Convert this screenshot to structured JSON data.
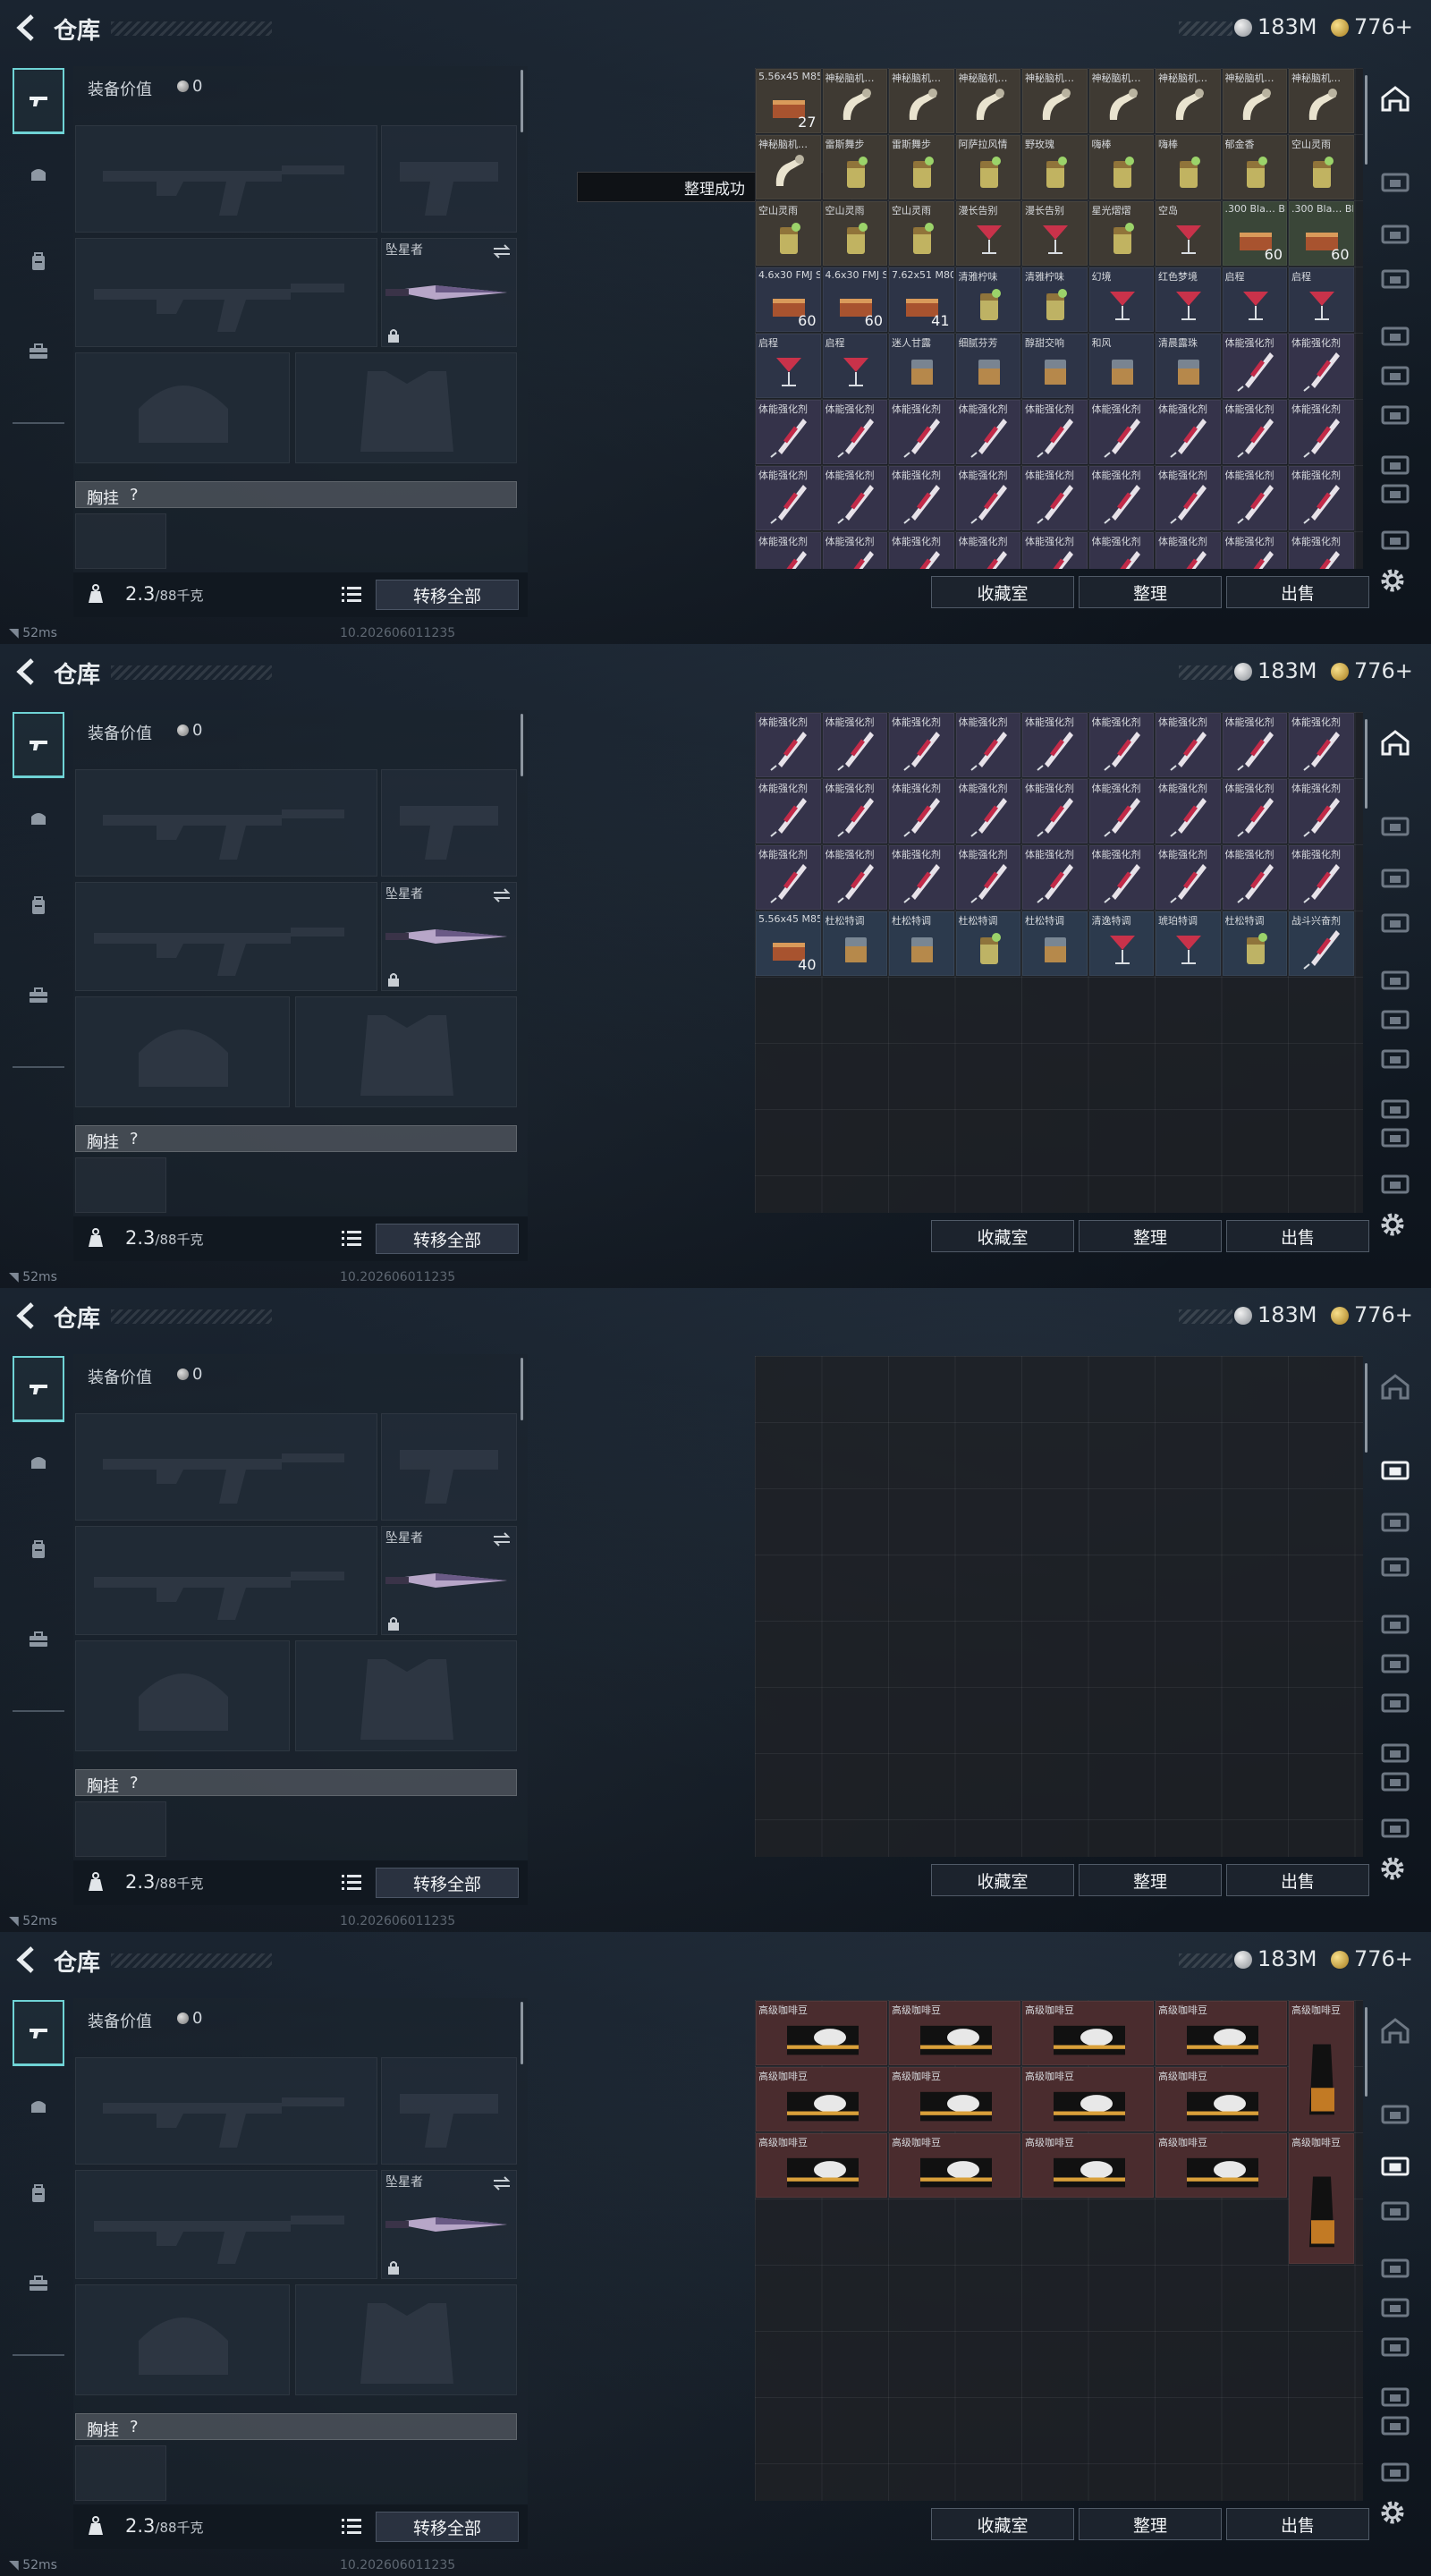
{
  "topbar": {
    "title": "仓库",
    "silver": "183M",
    "gold": "776+"
  },
  "equipment": {
    "value_label": "装备价值",
    "value": "0",
    "melee_label": "坠星者",
    "chest_label": "胸挂",
    "chest_help": "?",
    "weight": "2.3",
    "weight_max": "/88千克",
    "transfer_all": "转移全部"
  },
  "buttons": {
    "collect": "收藏室",
    "sort": "整理",
    "sell": "出售"
  },
  "toast": "整理成功",
  "status": {
    "ping": "52ms",
    "build": "10.202606011235"
  },
  "colors": {
    "accent": "#6fd3d5",
    "silver": "#b8bcc2",
    "gold": "#d3a53a"
  },
  "screens": [
    {
      "show_toast": true,
      "active_tab": 0,
      "cells": [
        {
          "n": "5.56x45 M855",
          "c": "27",
          "k": "ammo",
          "b": "brown"
        },
        {
          "n": "神秘脑机…",
          "c": "",
          "k": "device",
          "b": "brown"
        },
        {
          "n": "神秘脑机…",
          "c": "",
          "k": "device",
          "b": "brown"
        },
        {
          "n": "神秘脑机…",
          "c": "",
          "k": "device",
          "b": "brown"
        },
        {
          "n": "神秘脑机…",
          "c": "",
          "k": "device",
          "b": "brown"
        },
        {
          "n": "神秘脑机…",
          "c": "",
          "k": "device",
          "b": "brown"
        },
        {
          "n": "神秘脑机…",
          "c": "",
          "k": "device",
          "b": "brown"
        },
        {
          "n": "神秘脑机…",
          "c": "",
          "k": "device",
          "b": "brown"
        },
        {
          "n": "神秘脑机…",
          "c": "",
          "k": "device",
          "b": "brown"
        },
        {
          "n": "神秘脑机…",
          "c": "",
          "k": "device",
          "b": "brown"
        },
        {
          "n": "雷斯舞步",
          "c": "",
          "k": "drink",
          "b": "brown"
        },
        {
          "n": "雷斯舞步",
          "c": "",
          "k": "drink",
          "b": "brown"
        },
        {
          "n": "阿萨拉风情",
          "c": "",
          "k": "drink",
          "b": "brown"
        },
        {
          "n": "野玫瑰",
          "c": "",
          "k": "drink",
          "b": "brown"
        },
        {
          "n": "嗨棒",
          "c": "",
          "k": "drink",
          "b": "brown"
        },
        {
          "n": "嗨棒",
          "c": "",
          "k": "drink",
          "b": "brown"
        },
        {
          "n": "郁金香",
          "c": "",
          "k": "drink",
          "b": "brown"
        },
        {
          "n": "空山灵雨",
          "c": "",
          "k": "drink",
          "b": "brown"
        },
        {
          "n": "空山灵雨",
          "c": "",
          "k": "drink",
          "b": "brown"
        },
        {
          "n": "空山灵雨",
          "c": "",
          "k": "drink",
          "b": "brown"
        },
        {
          "n": "空山灵雨",
          "c": "",
          "k": "drink",
          "b": "brown"
        },
        {
          "n": "漫长告别",
          "c": "",
          "k": "cocktail",
          "b": "brown"
        },
        {
          "n": "漫长告别",
          "c": "",
          "k": "cocktail",
          "b": "brown"
        },
        {
          "n": "星光熠熠",
          "c": "",
          "k": "drink",
          "b": "brown"
        },
        {
          "n": "空岛",
          "c": "",
          "k": "cocktail",
          "b": "brown"
        },
        {
          "n": ".300 Bla… BLK FMJ",
          "c": "60",
          "k": "ammo",
          "b": "green"
        },
        {
          "n": ".300 Bla… BLK FMJ",
          "c": "60",
          "k": "ammo",
          "b": "green"
        },
        {
          "n": "4.6x30 FMJ SX",
          "c": "60",
          "k": "ammo",
          "b": "navy"
        },
        {
          "n": "4.6x30 FMJ SX",
          "c": "60",
          "k": "ammo",
          "b": "navy"
        },
        {
          "n": "7.62x51 M80",
          "c": "41",
          "k": "ammo",
          "b": "navy"
        },
        {
          "n": "清雅柠味",
          "c": "",
          "k": "drink",
          "b": "navy"
        },
        {
          "n": "清雅柠味",
          "c": "",
          "k": "drink",
          "b": "navy"
        },
        {
          "n": "幻境",
          "c": "",
          "k": "cocktail",
          "b": "navy"
        },
        {
          "n": "红色梦境",
          "c": "",
          "k": "cocktail",
          "b": "navy"
        },
        {
          "n": "启程",
          "c": "",
          "k": "cocktail",
          "b": "navy"
        },
        {
          "n": "启程",
          "c": "",
          "k": "cocktail",
          "b": "navy"
        },
        {
          "n": "启程",
          "c": "",
          "k": "cocktail",
          "b": "navy"
        },
        {
          "n": "启程",
          "c": "",
          "k": "cocktail",
          "b": "navy"
        },
        {
          "n": "迷人甘露",
          "c": "",
          "k": "glass",
          "b": "navy"
        },
        {
          "n": "细腻芬芳",
          "c": "",
          "k": "glass",
          "b": "navy"
        },
        {
          "n": "醇甜交响",
          "c": "",
          "k": "glass",
          "b": "navy"
        },
        {
          "n": "和风",
          "c": "",
          "k": "glass",
          "b": "navy"
        },
        {
          "n": "清晨露珠",
          "c": "",
          "k": "glass",
          "b": "navy"
        },
        {
          "n": "体能强化剂",
          "c": "",
          "k": "syringe",
          "b": "purple"
        },
        {
          "n": "体能强化剂",
          "c": "",
          "k": "syringe",
          "b": "purple"
        },
        {
          "n": "体能强化剂",
          "c": "",
          "k": "syringe",
          "b": "purple"
        },
        {
          "n": "体能强化剂",
          "c": "",
          "k": "syringe",
          "b": "purple"
        },
        {
          "n": "体能强化剂",
          "c": "",
          "k": "syringe",
          "b": "purple"
        },
        {
          "n": "体能强化剂",
          "c": "",
          "k": "syringe",
          "b": "purple"
        },
        {
          "n": "体能强化剂",
          "c": "",
          "k": "syringe",
          "b": "purple"
        },
        {
          "n": "体能强化剂",
          "c": "",
          "k": "syringe",
          "b": "purple"
        },
        {
          "n": "体能强化剂",
          "c": "",
          "k": "syringe",
          "b": "purple"
        },
        {
          "n": "体能强化剂",
          "c": "",
          "k": "syringe",
          "b": "purple"
        },
        {
          "n": "体能强化剂",
          "c": "",
          "k": "syringe",
          "b": "purple"
        },
        {
          "n": "体能强化剂",
          "c": "",
          "k": "syringe",
          "b": "purple"
        },
        {
          "n": "体能强化剂",
          "c": "",
          "k": "syringe",
          "b": "purple"
        },
        {
          "n": "体能强化剂",
          "c": "",
          "k": "syringe",
          "b": "purple"
        },
        {
          "n": "体能强化剂",
          "c": "",
          "k": "syringe",
          "b": "purple"
        },
        {
          "n": "体能强化剂",
          "c": "",
          "k": "syringe",
          "b": "purple"
        },
        {
          "n": "体能强化剂",
          "c": "",
          "k": "syringe",
          "b": "purple"
        },
        {
          "n": "体能强化剂",
          "c": "",
          "k": "syringe",
          "b": "purple"
        },
        {
          "n": "体能强化剂",
          "c": "",
          "k": "syringe",
          "b": "purple"
        },
        {
          "n": "体能强化剂",
          "c": "",
          "k": "syringe",
          "b": "purple"
        },
        {
          "n": "体能强化剂",
          "c": "",
          "k": "syringe",
          "b": "purple"
        },
        {
          "n": "体能强化剂",
          "c": "",
          "k": "syringe",
          "b": "purple"
        },
        {
          "n": "体能强化剂",
          "c": "",
          "k": "syringe",
          "b": "purple"
        },
        {
          "n": "体能强化剂",
          "c": "",
          "k": "syringe",
          "b": "purple"
        },
        {
          "n": "体能强化剂",
          "c": "",
          "k": "syringe",
          "b": "purple"
        },
        {
          "n": "体能强化剂",
          "c": "",
          "k": "syringe",
          "b": "purple"
        },
        {
          "n": "体能强化剂",
          "c": "",
          "k": "syringe",
          "b": "purple"
        },
        {
          "n": "体能强化剂",
          "c": "",
          "k": "syringe",
          "b": "purple"
        },
        {
          "n": "体能强化剂",
          "c": "",
          "k": "syringe",
          "b": "purple"
        }
      ]
    },
    {
      "show_toast": false,
      "active_tab": 0,
      "cells": [
        {
          "n": "体能强化剂",
          "c": "",
          "k": "syringe",
          "b": "purple"
        },
        {
          "n": "体能强化剂",
          "c": "",
          "k": "syringe",
          "b": "purple"
        },
        {
          "n": "体能强化剂",
          "c": "",
          "k": "syringe",
          "b": "purple"
        },
        {
          "n": "体能强化剂",
          "c": "",
          "k": "syringe",
          "b": "purple"
        },
        {
          "n": "体能强化剂",
          "c": "",
          "k": "syringe",
          "b": "purple"
        },
        {
          "n": "体能强化剂",
          "c": "",
          "k": "syringe",
          "b": "purple"
        },
        {
          "n": "体能强化剂",
          "c": "",
          "k": "syringe",
          "b": "purple"
        },
        {
          "n": "体能强化剂",
          "c": "",
          "k": "syringe",
          "b": "purple"
        },
        {
          "n": "体能强化剂",
          "c": "",
          "k": "syringe",
          "b": "purple"
        },
        {
          "n": "体能强化剂",
          "c": "",
          "k": "syringe",
          "b": "purple"
        },
        {
          "n": "体能强化剂",
          "c": "",
          "k": "syringe",
          "b": "purple"
        },
        {
          "n": "体能强化剂",
          "c": "",
          "k": "syringe",
          "b": "purple"
        },
        {
          "n": "体能强化剂",
          "c": "",
          "k": "syringe",
          "b": "purple"
        },
        {
          "n": "体能强化剂",
          "c": "",
          "k": "syringe",
          "b": "purple"
        },
        {
          "n": "体能强化剂",
          "c": "",
          "k": "syringe",
          "b": "purple"
        },
        {
          "n": "体能强化剂",
          "c": "",
          "k": "syringe",
          "b": "purple"
        },
        {
          "n": "体能强化剂",
          "c": "",
          "k": "syringe",
          "b": "purple"
        },
        {
          "n": "体能强化剂",
          "c": "",
          "k": "syringe",
          "b": "purple"
        },
        {
          "n": "体能强化剂",
          "c": "",
          "k": "syringe",
          "b": "purple"
        },
        {
          "n": "体能强化剂",
          "c": "",
          "k": "syringe",
          "b": "purple"
        },
        {
          "n": "体能强化剂",
          "c": "",
          "k": "syringe",
          "b": "purple"
        },
        {
          "n": "体能强化剂",
          "c": "",
          "k": "syringe",
          "b": "purple"
        },
        {
          "n": "体能强化剂",
          "c": "",
          "k": "syringe",
          "b": "purple"
        },
        {
          "n": "体能强化剂",
          "c": "",
          "k": "syringe",
          "b": "purple"
        },
        {
          "n": "体能强化剂",
          "c": "",
          "k": "syringe",
          "b": "purple"
        },
        {
          "n": "体能强化剂",
          "c": "",
          "k": "syringe",
          "b": "purple"
        },
        {
          "n": "体能强化剂",
          "c": "",
          "k": "syringe",
          "b": "purple"
        },
        {
          "n": "5.56x45 M855",
          "c": "40",
          "k": "ammo",
          "b": "blue"
        },
        {
          "n": "杜松特调",
          "c": "",
          "k": "glass",
          "b": "blue"
        },
        {
          "n": "杜松特调",
          "c": "",
          "k": "glass",
          "b": "blue"
        },
        {
          "n": "杜松特调",
          "c": "",
          "k": "drink",
          "b": "blue"
        },
        {
          "n": "杜松特调",
          "c": "",
          "k": "glass",
          "b": "blue"
        },
        {
          "n": "清逸特调",
          "c": "",
          "k": "cocktail",
          "b": "blue"
        },
        {
          "n": "琥珀特调",
          "c": "",
          "k": "cocktail",
          "b": "blue"
        },
        {
          "n": "杜松特调",
          "c": "",
          "k": "drink",
          "b": "blue"
        },
        {
          "n": "战斗兴奋剂",
          "c": "",
          "k": "syringe",
          "b": "blue"
        }
      ]
    },
    {
      "show_toast": false,
      "active_tab": 1,
      "cells": []
    },
    {
      "show_toast": false,
      "active_tab": 2,
      "cells": [
        {
          "n": "高级咖啡豆",
          "c": "",
          "k": "coffee",
          "b": "red",
          "w": 2,
          "h": 1
        },
        {
          "n": "",
          "c": "",
          "k": "skip",
          "b": "red"
        },
        {
          "n": "高级咖啡豆",
          "c": "",
          "k": "coffee",
          "b": "red",
          "w": 2,
          "h": 1
        },
        {
          "n": "",
          "c": "",
          "k": "skip",
          "b": "red"
        },
        {
          "n": "高级咖啡豆",
          "c": "",
          "k": "coffee",
          "b": "red",
          "w": 2,
          "h": 1
        },
        {
          "n": "",
          "c": "",
          "k": "skip",
          "b": "red"
        },
        {
          "n": "高级咖啡豆",
          "c": "",
          "k": "coffee",
          "b": "red",
          "w": 2,
          "h": 1
        },
        {
          "n": "",
          "c": "",
          "k": "skip",
          "b": "red"
        },
        {
          "n": "高级咖啡豆",
          "c": "",
          "k": "coffeebag",
          "b": "red",
          "w": 1,
          "h": 2
        },
        {
          "n": "高级咖啡豆",
          "c": "",
          "k": "coffee",
          "b": "red",
          "w": 2,
          "h": 1
        },
        {
          "n": "",
          "c": "",
          "k": "skip",
          "b": "red"
        },
        {
          "n": "高级咖啡豆",
          "c": "",
          "k": "coffee",
          "b": "red",
          "w": 2,
          "h": 1
        },
        {
          "n": "",
          "c": "",
          "k": "skip",
          "b": "red"
        },
        {
          "n": "高级咖啡豆",
          "c": "",
          "k": "coffee",
          "b": "red",
          "w": 2,
          "h": 1
        },
        {
          "n": "",
          "c": "",
          "k": "skip",
          "b": "red"
        },
        {
          "n": "高级咖啡豆",
          "c": "",
          "k": "coffee",
          "b": "red",
          "w": 2,
          "h": 1
        },
        {
          "n": "",
          "c": "",
          "k": "skip",
          "b": "red"
        },
        {
          "n": "",
          "c": "",
          "k": "skip",
          "b": "red"
        },
        {
          "n": "高级咖啡豆",
          "c": "",
          "k": "coffee",
          "b": "red",
          "w": 2,
          "h": 1
        },
        {
          "n": "",
          "c": "",
          "k": "skip",
          "b": "red"
        },
        {
          "n": "高级咖啡豆",
          "c": "",
          "k": "coffee",
          "b": "red",
          "w": 2,
          "h": 1
        },
        {
          "n": "",
          "c": "",
          "k": "skip",
          "b": "red"
        },
        {
          "n": "高级咖啡豆",
          "c": "",
          "k": "coffee",
          "b": "red",
          "w": 2,
          "h": 1
        },
        {
          "n": "",
          "c": "",
          "k": "skip",
          "b": "red"
        },
        {
          "n": "高级咖啡豆",
          "c": "",
          "k": "coffee",
          "b": "red",
          "w": 2,
          "h": 1
        },
        {
          "n": "",
          "c": "",
          "k": "skip",
          "b": "red"
        },
        {
          "n": "高级咖啡豆",
          "c": "",
          "k": "coffeebag",
          "b": "red",
          "w": 1,
          "h": 2
        }
      ]
    }
  ]
}
